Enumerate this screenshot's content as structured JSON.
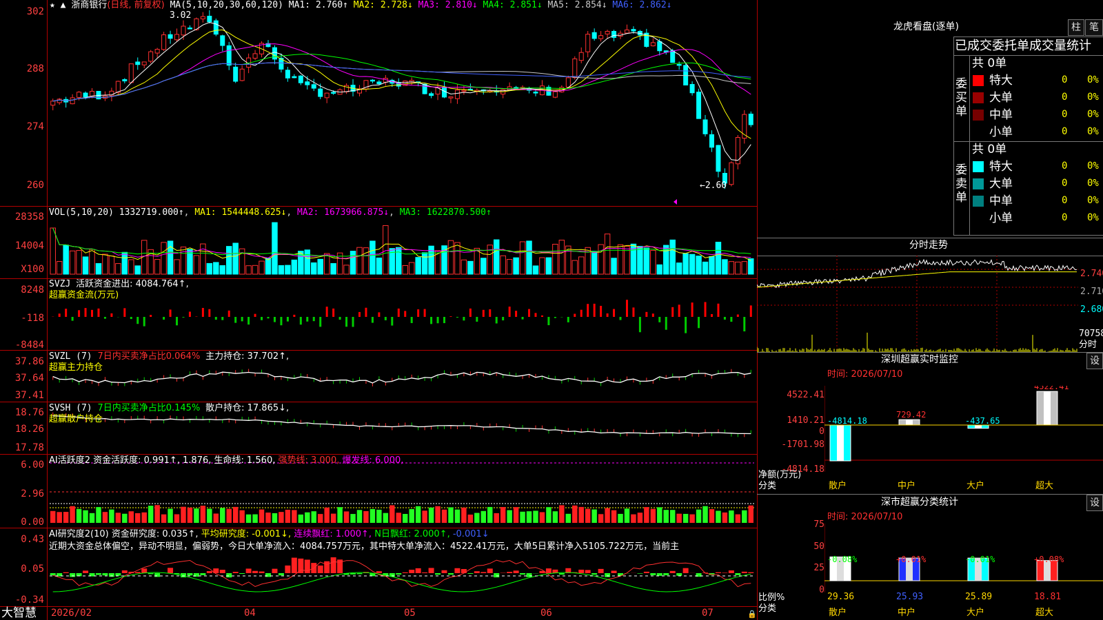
{
  "stock": {
    "name": "浙商银行",
    "period": "(日线, 前复权)",
    "ma_spec": "MA(5,10,20,30,60,120)",
    "ma1": "MA1: 2.760↑",
    "ma2": "MA2: 2.728↓",
    "ma3": "MA3: 2.810↓",
    "ma4": "MA4: 2.851↓",
    "ma5": "MA5: 2.854↓",
    "ma6": "MA6: 2.862↓",
    "high_label": "3.02",
    "low_label": "←2.60",
    "axis": [
      "302",
      "288",
      "274",
      "260"
    ]
  },
  "vol": {
    "spec": "VOL(5,10,20)",
    "value": "1332719.000↑",
    "ma1": "MA1: 1544448.625↓",
    "ma2": "MA2: 1673966.875↓",
    "ma3": "MA3: 1622870.500↑",
    "axis": [
      "28358",
      "14004",
      "X100"
    ]
  },
  "svzj": {
    "spec": "SVZJ",
    "title": "活跃资金进出: 4084.764↑,",
    "sub": "超赢资金流(万元)",
    "axis": [
      "8248",
      "-118",
      "-8484"
    ]
  },
  "svzl": {
    "spec": "SVZL (7)",
    "p1": "7日内买卖净占比0.064%",
    "p2": "主力持仓: 37.702↑,",
    "sub": "超赢主力持仓",
    "axis": [
      "37.86",
      "37.64",
      "37.41"
    ]
  },
  "svsh": {
    "spec": "SVSH (7)",
    "p1": "7日内买卖净占比0.145%",
    "p2": "散户持仓: 17.865↓,",
    "sub": "超赢散户持仓",
    "axis": [
      "18.76",
      "18.26",
      "17.78"
    ]
  },
  "ai_hyd": {
    "title": "AI活跃度2 资金活跃度: 0.991↑, 1.876, 生命线: 1.560,",
    "strong": "强势线: 3.000,",
    "burst": "爆发线: 6.000,",
    "axis": [
      "6.00",
      "2.96",
      "0.00"
    ]
  },
  "ai_yjd": {
    "title": "AI研究度2(10) 资金研究度: 0.035↑,",
    "avg": "平均研究度: -0.001↓,",
    "lx": "连续飘红: 1.000↑,",
    "nr": "N日飘红: 2.000↑,",
    "last": "-0.001↓",
    "text": "近期大资金总体偏空，异动不明显，偏弱势，今日大单净流入：4084.757万元，其中特大单净流入：4522.41万元，大单5日累计净入5105.722万元，当前主",
    "axis": [
      "0.43",
      "0.05",
      "-0.34"
    ]
  },
  "bottom": {
    "brand": "大智慧",
    "months": [
      "2026/02",
      "04",
      "05",
      "06",
      "07"
    ]
  },
  "lhb": {
    "title": "龙虎看盘(逐单)",
    "btn1": "柱",
    "btn2": "笔",
    "sub_title": "已成交委托单成交量统计",
    "buy_label": "委买单",
    "sell_label": "委卖单",
    "buy_total": "共 0单",
    "sell_total": "共 0单",
    "rows_buy": [
      {
        "name": "特大",
        "count": "0",
        "pct": "0%",
        "color": "#ff0000"
      },
      {
        "name": "大单",
        "count": "0",
        "pct": "0%",
        "color": "#990000"
      },
      {
        "name": "中单",
        "count": "0",
        "pct": "0%",
        "color": "#770000"
      },
      {
        "name": "小单",
        "count": "0",
        "pct": "0%",
        "color": "#000000"
      }
    ],
    "rows_sell": [
      {
        "name": "特大",
        "count": "0",
        "pct": "0%",
        "color": "#00ffff"
      },
      {
        "name": "大单",
        "count": "0",
        "pct": "0%",
        "color": "#009999"
      },
      {
        "name": "中单",
        "count": "0",
        "pct": "0%",
        "color": "#008080"
      },
      {
        "name": "小单",
        "count": "0",
        "pct": "0%",
        "color": "#000000"
      }
    ]
  },
  "fenshi": {
    "title": "分时走势",
    "p1": "2.740",
    "p2": "2.710",
    "p3": "2.680",
    "vol": "70758",
    "vol2": "分时"
  },
  "monitor": {
    "title": "深圳超赢实时监控",
    "btn": "设",
    "time": "时间: 2026/07/10",
    "axis": [
      "4522.41",
      "1410.21",
      "0",
      "-1701.98",
      "-4814.18"
    ],
    "bar_labels": [
      "-4814.18",
      "729.42",
      "-437.65",
      "4522.41"
    ],
    "cats": [
      "散户",
      "中户",
      "大户",
      "超大"
    ],
    "net": "净额(万元)",
    "cls": "分类"
  },
  "stats": {
    "title": "深市超赢分类统计",
    "btn": "设",
    "time": "时间: 2026/07/10",
    "axis": [
      "75",
      "50",
      "25",
      "0"
    ],
    "changes": [
      "-0.08%",
      "+0.01%",
      "-0.01%",
      "+0.08%"
    ],
    "values": [
      "29.36",
      "25.93",
      "25.89",
      "18.81"
    ],
    "cats": [
      "散户",
      "中户",
      "大户",
      "超大"
    ],
    "ratio": "比例%",
    "cls": "分类"
  }
}
